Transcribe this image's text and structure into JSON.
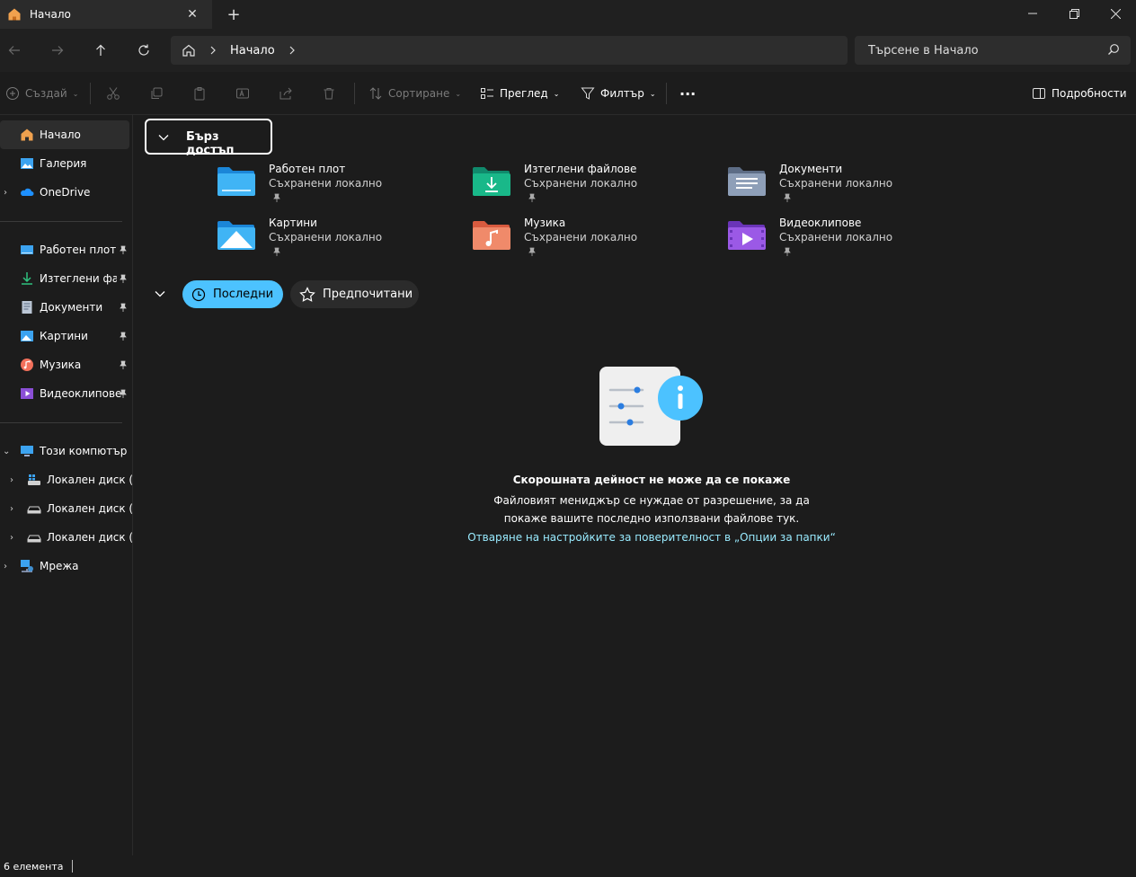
{
  "window": {
    "tab_title": "Начало",
    "new_tab": "+",
    "minimize": "—",
    "maximize": "❐",
    "close": "✕"
  },
  "address": {
    "crumb": "Начало",
    "search_placeholder": "Търсене в Начало"
  },
  "toolbar": {
    "create": "Създай",
    "sort": "Сортиране",
    "view": "Преглед",
    "filter": "Филтър",
    "more": "···",
    "details": "Подробности"
  },
  "sidebar": {
    "top": [
      {
        "label": "Начало",
        "icon": "home-icon"
      },
      {
        "label": "Галерия",
        "icon": "gallery-icon"
      },
      {
        "label": "OneDrive",
        "icon": "onedrive-icon"
      }
    ],
    "pinned": [
      {
        "label": "Работен плот",
        "icon": "desktop-icon"
      },
      {
        "label": "Изтеглени файл",
        "icon": "downloads-icon"
      },
      {
        "label": "Документи",
        "icon": "documents-icon"
      },
      {
        "label": "Картини",
        "icon": "pictures-icon"
      },
      {
        "label": "Музика",
        "icon": "music-icon"
      },
      {
        "label": "Видеоклипове",
        "icon": "videos-icon"
      }
    ],
    "this_pc": "Този компютър",
    "drives": [
      {
        "label": "Локален диск (C:"
      },
      {
        "label": "Локален диск (D:"
      },
      {
        "label": "Локален диск (F:)"
      }
    ],
    "network": "Мрежа"
  },
  "quick_access": {
    "header": "Бърз достъп",
    "items": [
      {
        "name": "Работен плот",
        "sub": "Съхранени локално"
      },
      {
        "name": "Изтеглени файлове",
        "sub": "Съхранени локално"
      },
      {
        "name": "Документи",
        "sub": "Съхранени локално"
      },
      {
        "name": "Картини",
        "sub": "Съхранени локално"
      },
      {
        "name": "Музика",
        "sub": "Съхранени локално"
      },
      {
        "name": "Видеоклипове",
        "sub": "Съхранени локално"
      }
    ]
  },
  "tabs": {
    "recent": "Последни",
    "favorites": "Предпочитани"
  },
  "empty": {
    "title": "Скорошната дейност не може да се покаже",
    "desc": "Файловият мениджър се нуждае от разрешение, за да покаже вашите последно използвани файлове тук.",
    "link": "Отваряне на настройките за поверителност в „Опции за папки“"
  },
  "status": {
    "count": "6 елемента"
  },
  "colors": {
    "accent": "#4cc2ff",
    "link": "#99ebff",
    "background": "#1c1c1c"
  }
}
